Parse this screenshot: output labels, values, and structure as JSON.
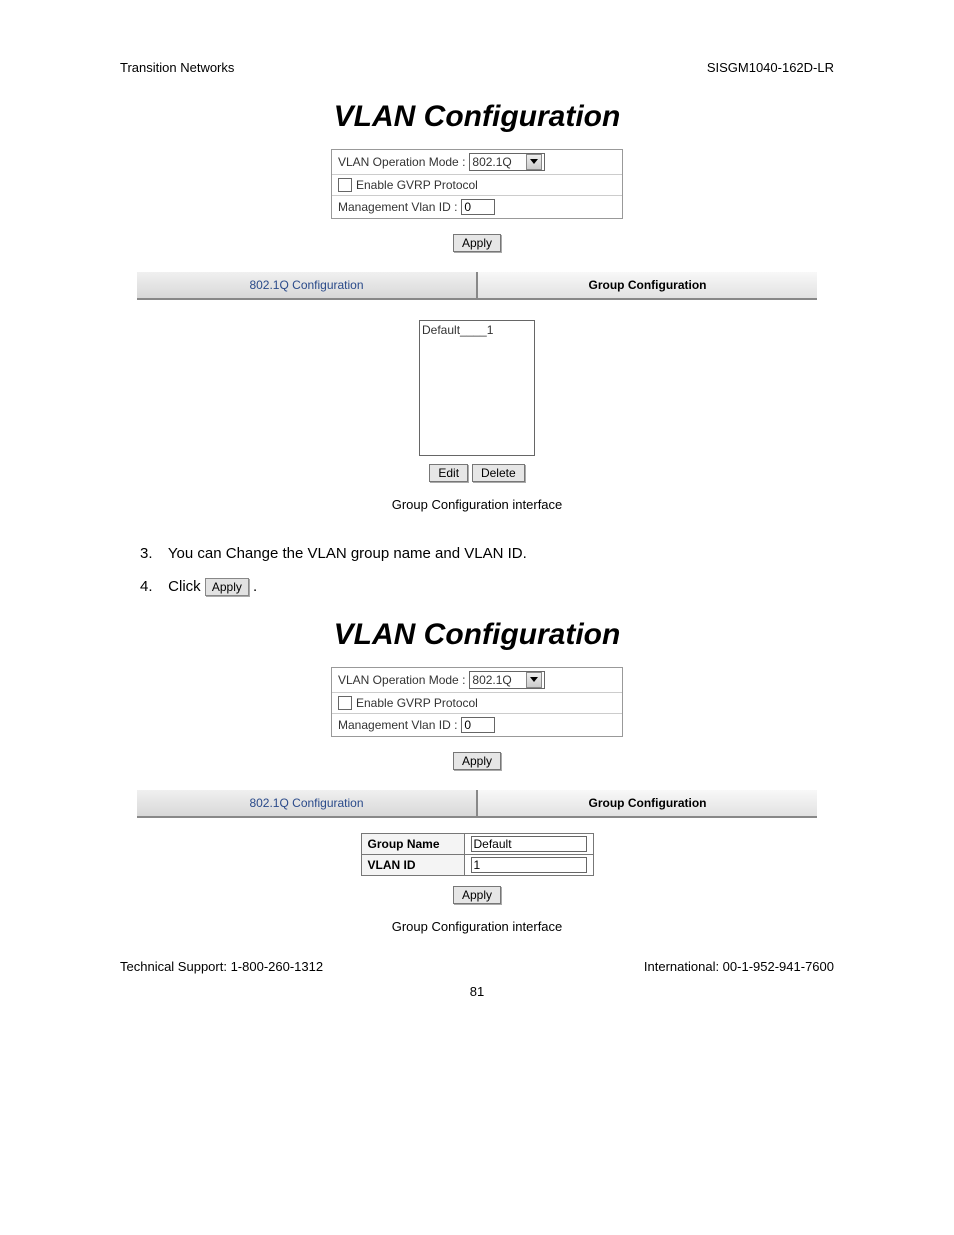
{
  "header": {
    "left": "Transition Networks",
    "right": "SISGM1040-162D-LR"
  },
  "title": "VLAN Configuration",
  "config": {
    "op_mode_label": "VLAN Operation Mode :",
    "op_mode_value": "802.1Q",
    "gvrp_label": "Enable GVRP Protocol",
    "mgmt_vlan_label": "Management Vlan ID :",
    "mgmt_vlan_value": "0"
  },
  "buttons": {
    "apply": "Apply",
    "edit": "Edit",
    "delete": "Delete"
  },
  "tabs": {
    "t1": "802.1Q Configuration",
    "t2": "Group Configuration"
  },
  "listbox_item": "Default____1",
  "caption": "Group Configuration interface",
  "steps": {
    "s3_num": "3.",
    "s3_text": "You can Change the VLAN group name and VLAN ID.",
    "s4_num": "4.",
    "s4_text_a": "Click ",
    "s4_text_b": " ."
  },
  "mini_table": {
    "group_name_label": "Group Name",
    "group_name_value": "Default",
    "vlan_id_label": "VLAN ID",
    "vlan_id_value": "1"
  },
  "footer": {
    "left": "Technical Support: 1-800-260-1312",
    "right": "International: 00-1-952-941-7600",
    "page": "81"
  }
}
